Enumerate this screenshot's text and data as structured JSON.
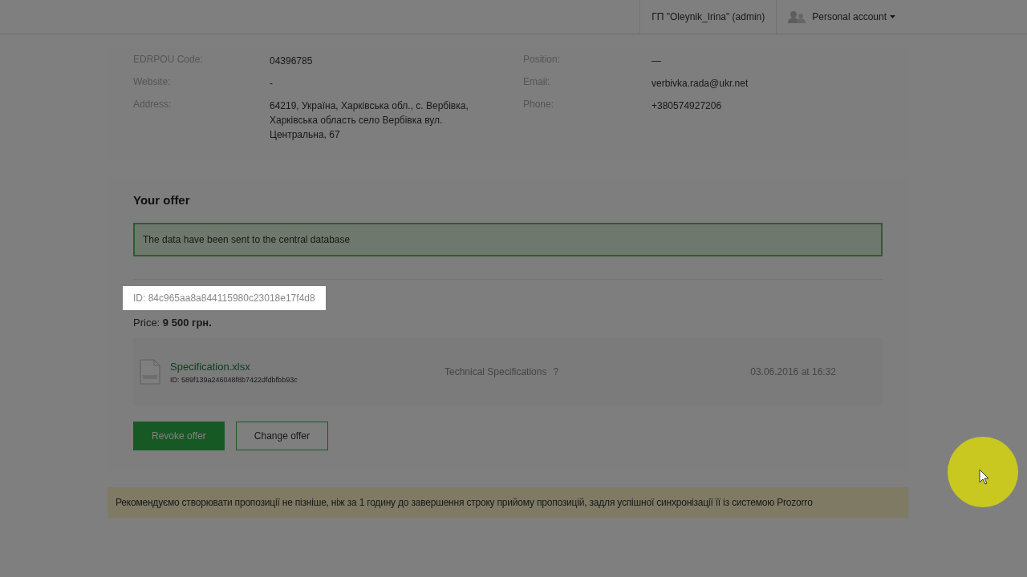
{
  "header": {
    "user": "ГП \"Oleynik_Irina\" (admin)",
    "account": "Personal account"
  },
  "details": {
    "left": [
      {
        "label": "EDRPOU Code:",
        "value": "04396785"
      },
      {
        "label": "Website:",
        "value": "-"
      },
      {
        "label": "Address:",
        "value": "64219, Україна, Харківська обл., с. Вербівка, Харківська область село Вербівка вул. Центральна, 67"
      }
    ],
    "right": [
      {
        "label": "Position:",
        "value": "—"
      },
      {
        "label": "Email:",
        "value": "verbivka.rada@ukr.net"
      },
      {
        "label": "Phone:",
        "value": "+380574927206"
      }
    ]
  },
  "offer": {
    "title": "Your offer",
    "alert": "The data have been sent to the central database",
    "id": "ID: 84c965aa8a844115980c23018e17f4d8",
    "price": "Price: **9 500 грн.**",
    "document": {
      "name": "Specification.xlsx",
      "id": "ID: 589f139a246048f8b7422dfdbfbb93c",
      "type": "Technical Specifications",
      "help": "?",
      "date": "03.06.2016 at 16:32"
    },
    "buttons": [
      {
        "label": "Revoke offer",
        "kind": "primary"
      },
      {
        "label": "Change offer",
        "kind": "secondary"
      }
    ]
  },
  "notice": "Рекомендуємо створювати пропозиції не пізніше, ніж за 1 годину до завершення строку прийому пропозицій, задля успішної синхронізації її із системою Prozorro"
}
